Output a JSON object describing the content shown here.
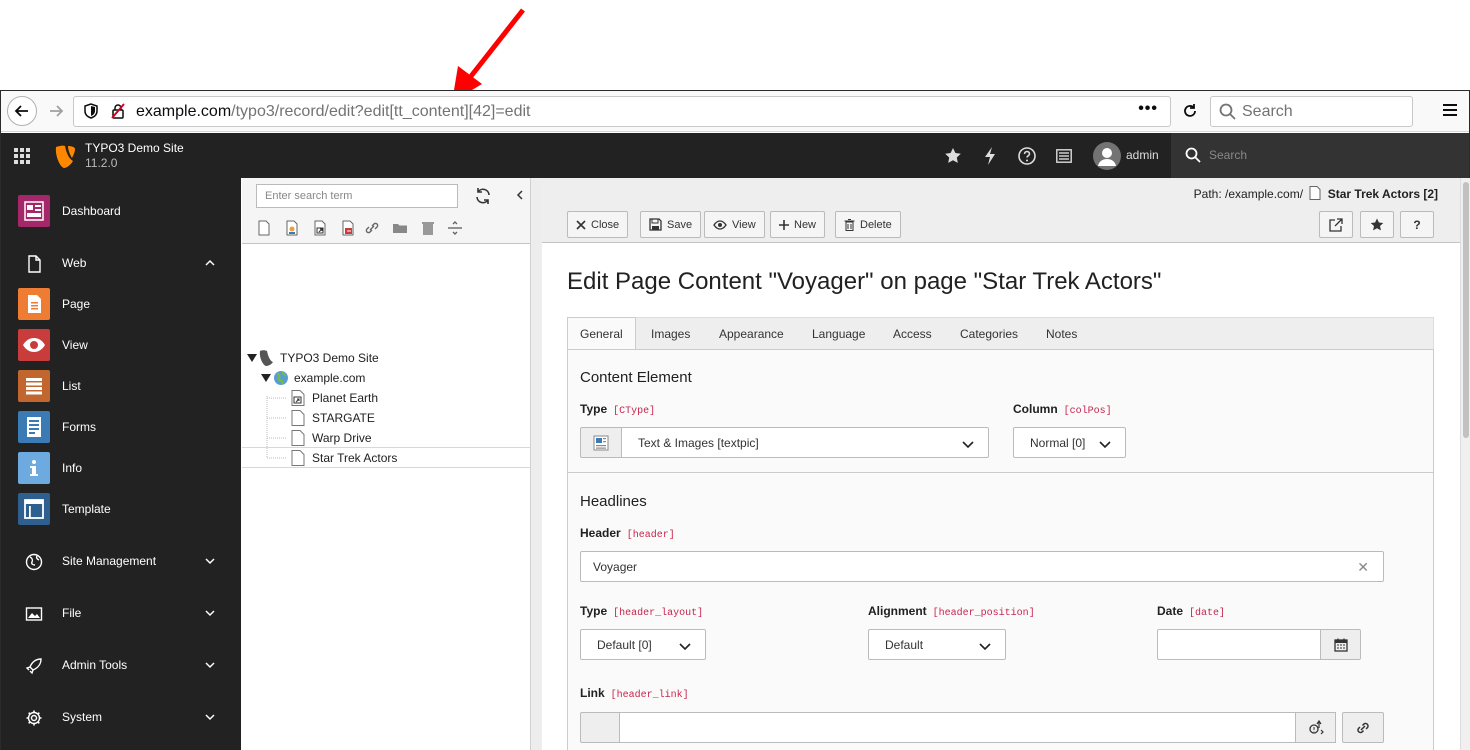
{
  "browser": {
    "url_host": "example.com",
    "url_path": "/typo3/record/edit?edit[tt_content][42]=edit",
    "search_placeholder": "Search"
  },
  "topbar": {
    "site_title": "TYPO3 Demo Site",
    "site_version": "11.2.0",
    "user_name": "admin",
    "search_placeholder": "Search"
  },
  "modmenu": {
    "dashboard": "Dashboard",
    "web": "Web",
    "page": "Page",
    "view": "View",
    "list": "List",
    "forms": "Forms",
    "info": "Info",
    "template": "Template",
    "site_management": "Site Management",
    "file": "File",
    "admin_tools": "Admin Tools",
    "system": "System",
    "colors": {
      "dashboard": "#a4276a",
      "page": "#ee7d33",
      "view": "#c83c3c",
      "list": "#c2662f",
      "forms": "#3a7ab5",
      "info": "#6daae0",
      "template": "#2f5f8e"
    }
  },
  "tree": {
    "search_placeholder": "Enter search term",
    "root": "TYPO3 Demo Site",
    "site": "example.com",
    "pages": [
      "Planet Earth",
      "STARGATE",
      "Warp Drive",
      "Star Trek Actors"
    ]
  },
  "docheader": {
    "path_label": "Path: /example.com/",
    "path_page": "Star Trek Actors [2]",
    "close": "Close",
    "save": "Save",
    "view": "View",
    "new": "New",
    "delete": "Delete",
    "help": "?"
  },
  "form": {
    "title": "Edit Page Content \"Voyager\" on page \"Star Trek Actors\"",
    "tabs": [
      "General",
      "Images",
      "Appearance",
      "Language",
      "Access",
      "Categories",
      "Notes"
    ],
    "content_element": {
      "title": "Content Element",
      "type_label": "Type",
      "type_key": "[CType]",
      "type_value": "Text & Images [textpic]",
      "column_label": "Column",
      "column_key": "[colPos]",
      "column_value": "Normal [0]"
    },
    "headlines": {
      "title": "Headlines",
      "header_label": "Header",
      "header_key": "[header]",
      "header_value": "Voyager",
      "type_label": "Type",
      "type_key": "[header_layout]",
      "type_value": "Default [0]",
      "alignment_label": "Alignment",
      "alignment_key": "[header_position]",
      "alignment_value": "Default",
      "date_label": "Date",
      "date_key": "[date]",
      "link_label": "Link",
      "link_key": "[header_link]"
    }
  }
}
